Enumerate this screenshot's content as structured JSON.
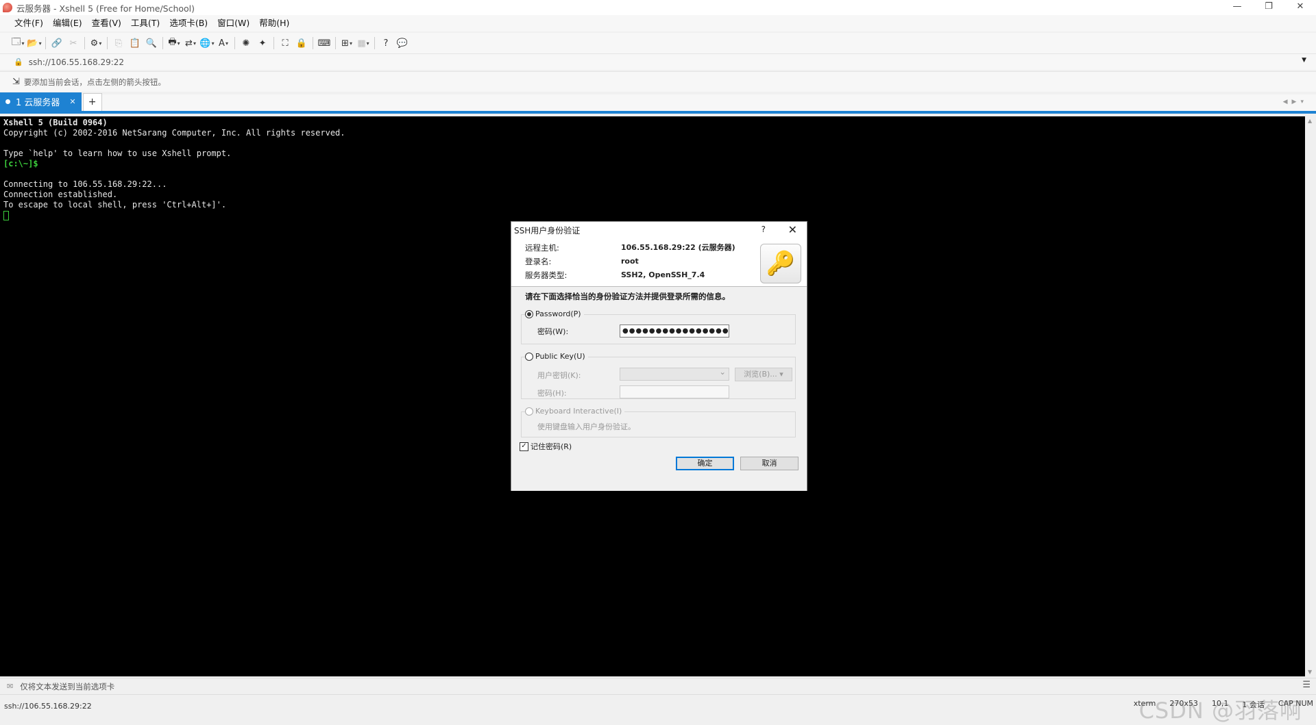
{
  "window": {
    "title": "云服务器 - Xshell 5 (Free for Home/School)"
  },
  "menu": [
    "文件(F)",
    "编辑(E)",
    "查看(V)",
    "工具(T)",
    "选项卡(B)",
    "窗口(W)",
    "帮助(H)"
  ],
  "address": {
    "value": "ssh://106.55.168.29:22"
  },
  "hint": {
    "text": "要添加当前会话，点击左侧的箭头按钮。"
  },
  "tabs": [
    {
      "label": "1 云服务器"
    }
  ],
  "terminal": {
    "line1": "Xshell 5 (Build 0964)",
    "line2": "Copyright (c) 2002-2016 NetSarang Computer, Inc. All rights reserved.",
    "line3": "Type `help' to learn how to use Xshell prompt.",
    "prompt": "[c:\\~]$",
    "line5": "Connecting to 106.55.168.29:22...",
    "line6": "Connection established.",
    "line7": "To escape to local shell, press 'Ctrl+Alt+]'."
  },
  "dialog": {
    "title": "SSH用户身份验证",
    "help": "?",
    "remote_host_label": "远程主机:",
    "remote_host_value": "106.55.168.29:22 (云服务器)",
    "login_label": "登录名:",
    "login_value": "root",
    "server_type_label": "服务器类型:",
    "server_type_value": "SSH2, OpenSSH_7.4",
    "instruction": "请在下面选择恰当的身份验证方法并提供登录所需的信息。",
    "password_radio": "Password(P)",
    "password_label": "密码(W):",
    "password_value": "●●●●●●●●●●●●●●●●",
    "publickey_radio": "Public Key(U)",
    "user_key_label": "用户密钥(K):",
    "browse_label": "浏览(B)... ▾",
    "passphrase_label": "密码(H):",
    "keyboard_radio": "Keyboard Interactive(I)",
    "keyboard_desc": "使用键盘输入用户身份验证。",
    "remember_label": "记住密码(R)",
    "ok_label": "确定",
    "cancel_label": "取消"
  },
  "compose": {
    "text": "仅将文本发送到当前选项卡"
  },
  "status": {
    "address": "ssh://106.55.168.29:22",
    "term": "xterm",
    "size": "270x53",
    "pos": "10,1",
    "sessions": "1 会话",
    "caps": "CAP NUM"
  },
  "watermark": "CSDN @羽落啊"
}
